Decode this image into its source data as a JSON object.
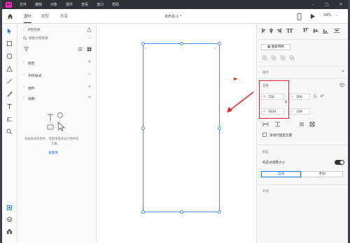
{
  "titlebar": {
    "logo_text": "Xd",
    "menu": [
      "文件",
      "编辑",
      "对象",
      "插件",
      "查看",
      "窗口",
      "帮助"
    ]
  },
  "toolbar": {
    "tabs": [
      "设计",
      "原型",
      "共享"
    ],
    "doc_title": "未命名-1 *",
    "zoom": "34%"
  },
  "left_panel": {
    "breadcrumb": "文档资源",
    "search_placeholder": "搜索文档资源",
    "sections": [
      "颜色",
      "字符样式",
      "组件",
      "视频"
    ],
    "empty_text_line1": "添加样式和组件，或使用现有设计图中的",
    "empty_text_line2": "元素。",
    "view_library": "查看库"
  },
  "right_panel": {
    "repeat_grid": "重复网格",
    "group_section": "组件",
    "transform_section": "变换",
    "w_label": "W",
    "w_value": "750",
    "h_label": "H",
    "h_value": "1624",
    "x_label": "X",
    "x_value": "706",
    "y_label": "Y",
    "y_value": "328",
    "rotation_value": "0°",
    "fix_position": "滚动时固定位置",
    "responsive_section": "响应",
    "responsive_resize": "响应式调整大小",
    "auto_button": "自动",
    "manual_button": "手动",
    "appearance_section": "外观"
  },
  "colors": {
    "accent": "#4a90e2",
    "red_highlight": "#e3262c",
    "xd_pink": "#ff2bc2",
    "link_blue": "#1473e6"
  }
}
